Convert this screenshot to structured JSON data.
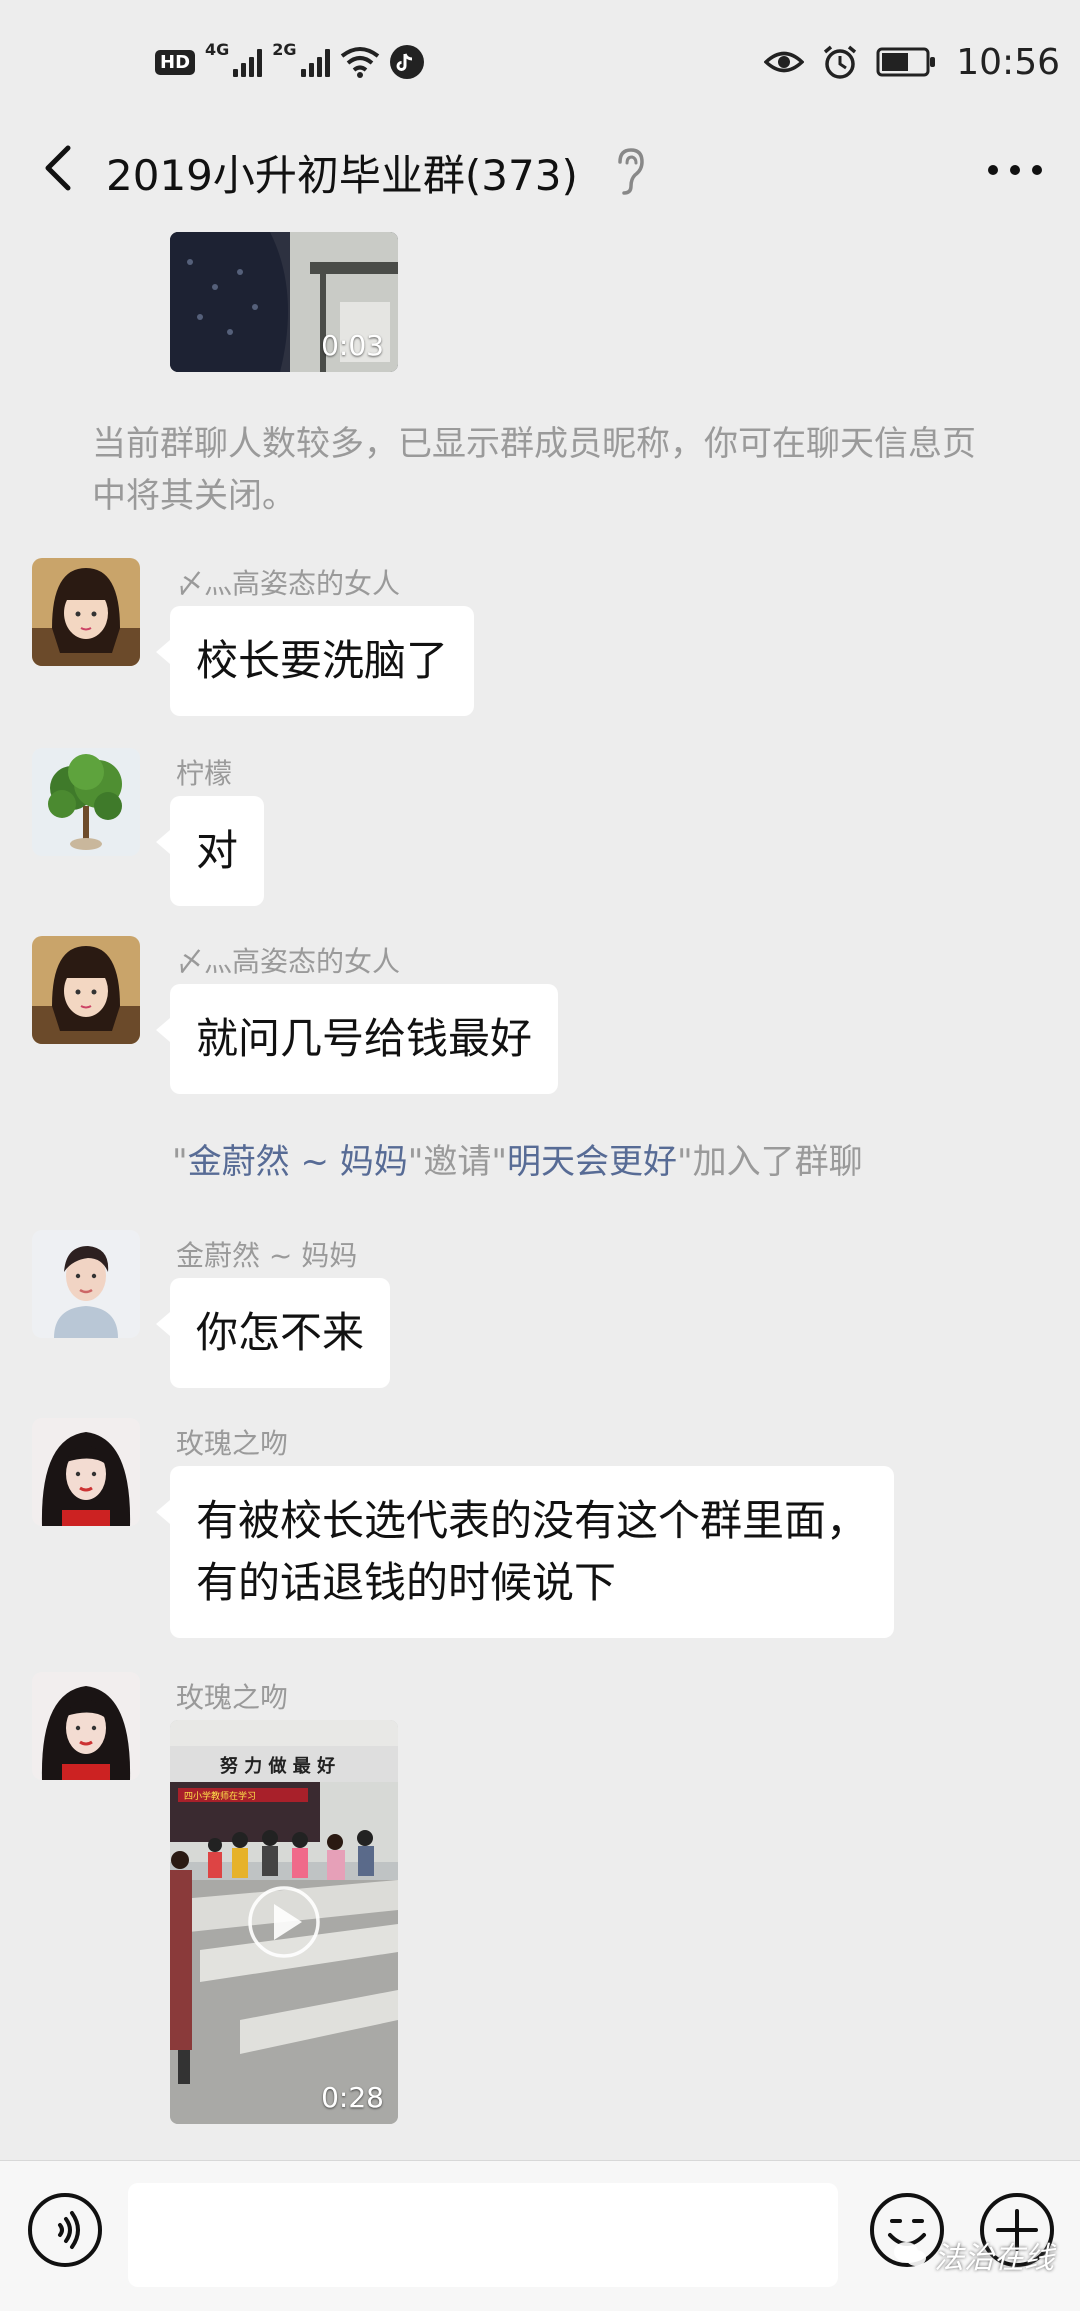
{
  "status_bar": {
    "hd_badge": "HD",
    "signal1": "4G",
    "signal2": "2G",
    "time": "10:56"
  },
  "nav": {
    "title": "2019小升初毕业群(373)"
  },
  "video_top": {
    "duration": "0:03"
  },
  "system_notice": "当前群聊人数较多，已显示群成员昵称，你可在聊天信息页中将其关闭。",
  "messages": [
    {
      "nickname": "〆灬高姿态的女人",
      "text": "校长要洗脑了"
    },
    {
      "nickname": "柠檬",
      "text": "对"
    },
    {
      "nickname": "〆灬高姿态的女人",
      "text": "就问几号给钱最好"
    },
    {
      "nickname": "金蔚然 ~ 妈妈",
      "text": "你怎不来"
    },
    {
      "nickname": "玫瑰之吻",
      "text": "有被校长选代表的没有这个群里面，\n有的话退钱的时候说下"
    },
    {
      "nickname": "玫瑰之吻",
      "duration": "0:28"
    }
  ],
  "join_notice": {
    "q1": "\"",
    "inviter": "金蔚然 ~ 妈妈",
    "mid": "\"邀请\"",
    "invitee": "明天会更好",
    "tail": "\"加入了群聊"
  },
  "video_classroom": {
    "banner": "努 力 做 最 好",
    "sub_banner": "四小学教师在学习"
  },
  "watermark": "法治在线"
}
